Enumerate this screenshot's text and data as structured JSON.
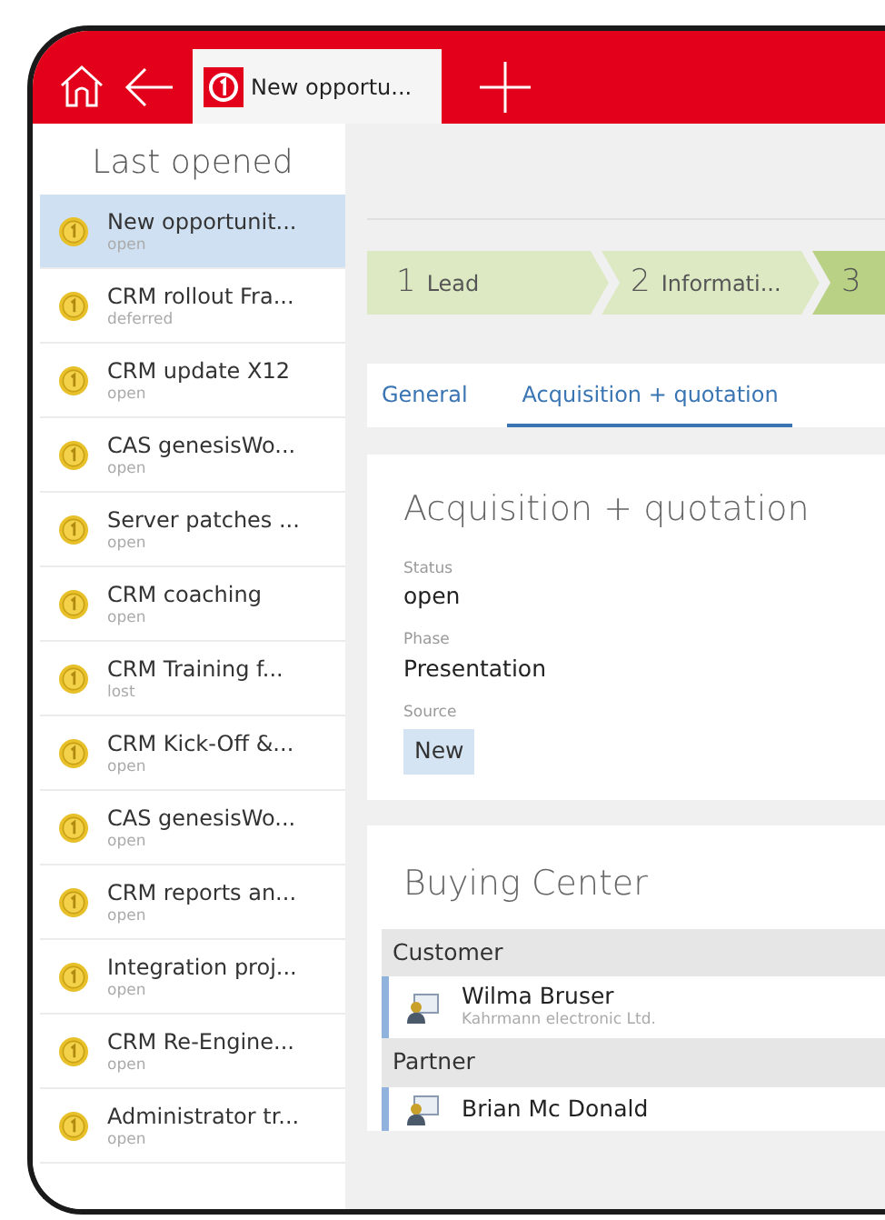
{
  "header": {
    "tab": {
      "title": "New opportu..."
    }
  },
  "sidebar": {
    "title": "Last opened",
    "items": [
      {
        "title": "New opportunit...",
        "status": "open",
        "selected": true
      },
      {
        "title": "CRM rollout Fra...",
        "status": "deferred",
        "selected": false
      },
      {
        "title": "CRM update X12",
        "status": "open",
        "selected": false
      },
      {
        "title": "CAS genesisWo...",
        "status": "open",
        "selected": false
      },
      {
        "title": "Server patches ...",
        "status": "open",
        "selected": false
      },
      {
        "title": "CRM coaching",
        "status": "open",
        "selected": false
      },
      {
        "title": "CRM Training f...",
        "status": "lost",
        "selected": false
      },
      {
        "title": "CRM Kick-Off &...",
        "status": "open",
        "selected": false
      },
      {
        "title": "CAS genesisWo...",
        "status": "open",
        "selected": false
      },
      {
        "title": "CRM reports an...",
        "status": "open",
        "selected": false
      },
      {
        "title": "Integration proj...",
        "status": "open",
        "selected": false
      },
      {
        "title": "CRM Re-Engine...",
        "status": "open",
        "selected": false
      },
      {
        "title": "Administrator tr...",
        "status": "open",
        "selected": false
      }
    ]
  },
  "steps": [
    {
      "number": "1",
      "label": "Lead",
      "current": false
    },
    {
      "number": "2",
      "label": "Informati...",
      "current": false
    },
    {
      "number": "3",
      "current": true
    }
  ],
  "tabs": [
    {
      "label": "General",
      "selected": false
    },
    {
      "label": "Acquisition + quotation",
      "selected": true
    }
  ],
  "details": {
    "title": "Acquisition + quotation",
    "fields": [
      {
        "kind": "text",
        "label": "Status",
        "value": "open"
      },
      {
        "kind": "text",
        "label": "Phase",
        "value": "Presentation"
      },
      {
        "kind": "tag",
        "label": "Source",
        "value": "New"
      }
    ]
  },
  "buying_center": {
    "title": "Buying Center",
    "groups": [
      {
        "name": "Customer",
        "people": [
          {
            "name": "Wilma Bruser",
            "company": "Kahrmann electronic Ltd."
          }
        ]
      },
      {
        "name": "Partner",
        "people": [
          {
            "name": "Brian Mc Donald"
          }
        ]
      }
    ]
  }
}
